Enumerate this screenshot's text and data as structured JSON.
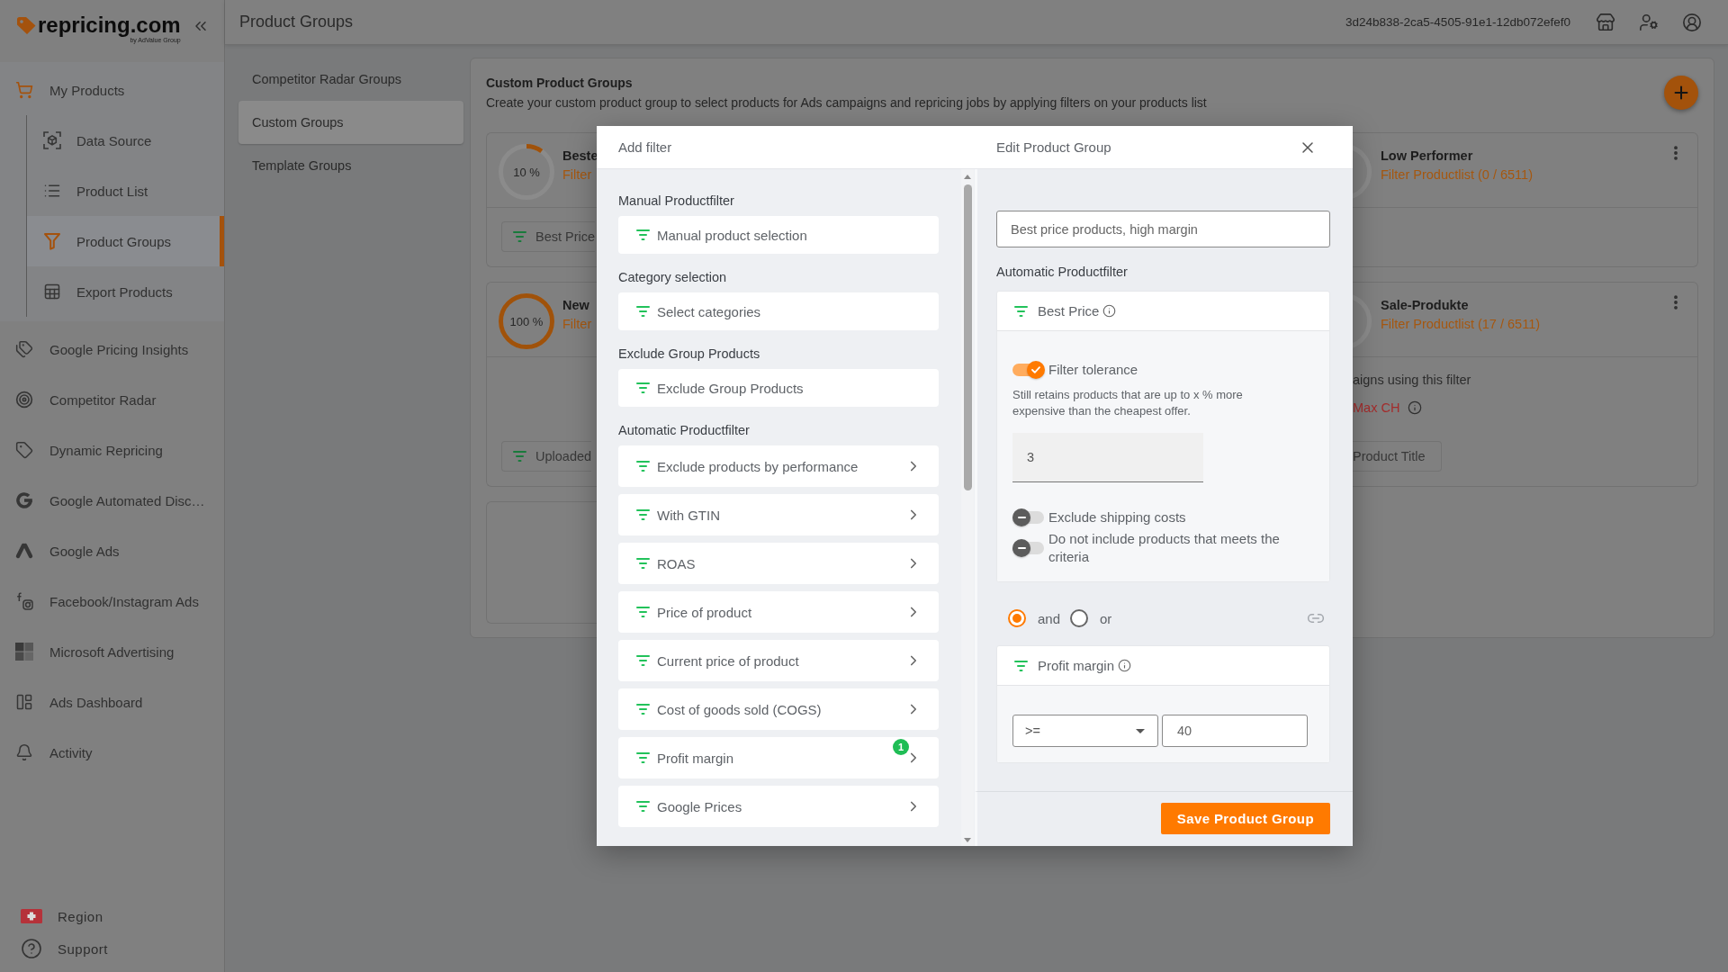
{
  "sidebar": {
    "brand": {
      "name": "repricing.com",
      "tagline": "by AdValue Group"
    },
    "nav": [
      {
        "label": "My Products",
        "selected": false,
        "expanded": true,
        "children": [
          {
            "label": "Data Source",
            "selected": false
          },
          {
            "label": "Product List",
            "selected": false
          },
          {
            "label": "Product Groups",
            "selected": true
          },
          {
            "label": "Export Products",
            "selected": false
          }
        ]
      },
      {
        "label": "Google Pricing Insights",
        "selected": false
      },
      {
        "label": "Competitor Radar",
        "selected": false
      },
      {
        "label": "Dynamic Repricing",
        "selected": false
      },
      {
        "label": "Google Automated Disc…",
        "selected": false
      },
      {
        "label": "Google Ads",
        "selected": false
      },
      {
        "label": "Facebook/Instagram Ads",
        "selected": false
      },
      {
        "label": "Microsoft Advertising",
        "selected": false
      },
      {
        "label": "Ads Dashboard",
        "selected": false
      },
      {
        "label": "Activity",
        "selected": false
      }
    ],
    "footer": [
      {
        "label": "Region"
      },
      {
        "label": "Support"
      }
    ]
  },
  "top_bar": {
    "title": "Product Groups",
    "account_id": "3d24b838-2ca5-4505-91e1-12db072efef0"
  },
  "group_tabs": [
    {
      "label": "Competitor Radar Groups",
      "selected": false
    },
    {
      "label": "Custom Groups",
      "selected": true
    },
    {
      "label": "Template Groups",
      "selected": false
    }
  ],
  "panel": {
    "title": "Custom Product Groups",
    "description": "Create your custom product group to select products for Ads campaigns and repricing jobs by applying filters on your products list"
  },
  "cards_left": [
    {
      "kind": "group",
      "ring_label": "10 %",
      "level": 0.1,
      "title": "Beste",
      "filter_link": "Filter",
      "chips": [
        "Best Price"
      ]
    },
    {
      "kind": "group",
      "ring_label": "100 %",
      "level": 1,
      "title": "New",
      "filter_link": "Filter",
      "chips": [
        "Uploaded"
      ]
    },
    {
      "kind": "blank"
    }
  ],
  "cards_right": [
    {
      "kind": "group",
      "title": "Low Performer",
      "filter_link": "Filter Productlist (0 / 6511)"
    },
    {
      "kind": "group",
      "title": "Sale-Produkte",
      "filter_link": "Filter Productlist (17 / 6511)",
      "campaigns_label": "aigns using this filter",
      "campaigns": [
        "Max CH"
      ],
      "chips": [
        "Product Title"
      ]
    }
  ],
  "add_filter": {
    "title": "Add filter",
    "sections": [
      {
        "title": "Manual Productfilter",
        "options": [
          {
            "label": "Manual product selection",
            "submenu": false
          }
        ]
      },
      {
        "title": "Category selection",
        "options": [
          {
            "label": "Select categories",
            "submenu": false
          }
        ]
      },
      {
        "title": "Exclude Group Products",
        "options": [
          {
            "label": "Exclude Group Products",
            "submenu": false
          }
        ]
      },
      {
        "title": "Automatic Productfilter",
        "options": [
          {
            "label": "Exclude products by performance",
            "submenu": true
          },
          {
            "label": "With GTIN",
            "submenu": true
          },
          {
            "label": "ROAS",
            "submenu": true
          },
          {
            "label": "Price of product",
            "submenu": true
          },
          {
            "label": "Current price of product",
            "submenu": true
          },
          {
            "label": "Cost of goods sold (COGS)",
            "submenu": true
          },
          {
            "label": "Profit margin",
            "submenu": true,
            "badge": "1"
          },
          {
            "label": "Google Prices",
            "submenu": true
          }
        ]
      }
    ]
  },
  "edit_group": {
    "title": "Edit Product Group",
    "name": "Best price products, high margin",
    "filters_title": "Automatic Productfilter",
    "items": [
      {
        "kind": "toggle-filter",
        "title": "Best Price",
        "options": [
          {
            "label": "Filter tolerance",
            "on": true,
            "description": "Still retains products that are up to x % more expensive than the cheapest offer.",
            "value": "3"
          },
          {
            "label": "Exclude shipping costs",
            "on": false
          },
          {
            "label": "Do not include products that meets the criteria",
            "on": false
          }
        ]
      },
      {
        "kind": "logic",
        "options": [
          {
            "label": "and",
            "selected": true
          },
          {
            "label": "or",
            "selected": false
          }
        ]
      },
      {
        "kind": "compare-filter",
        "title": "Profit margin",
        "operator": ">=",
        "value": "40"
      }
    ],
    "save_button": "Save Product Group"
  }
}
